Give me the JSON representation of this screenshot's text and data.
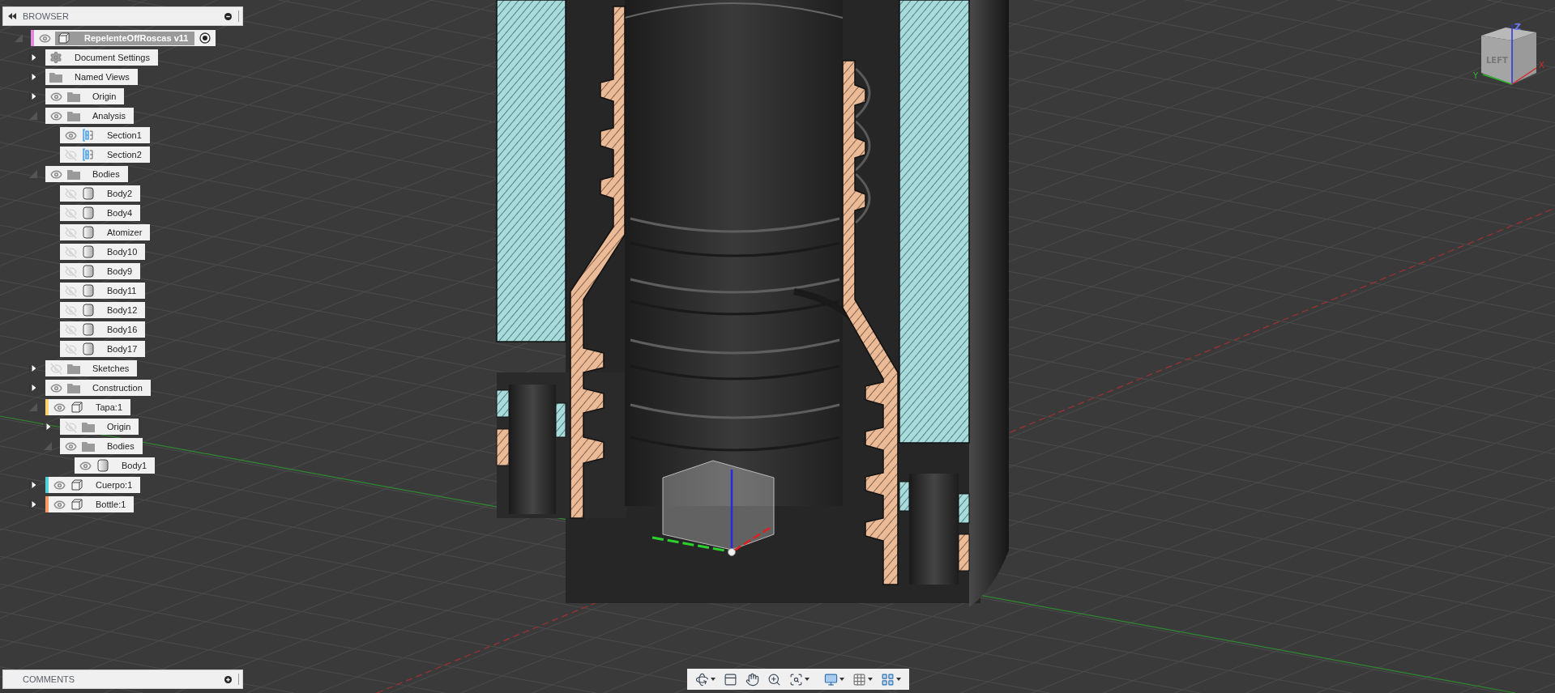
{
  "browser": {
    "title": "BROWSER",
    "root": {
      "label": "RepelenteOffRoscas v11",
      "kind": "component",
      "visible": true,
      "expanded": true,
      "color": "#e08ae0",
      "active": true,
      "children": [
        {
          "label": "Document Settings",
          "kind": "gear",
          "expanded": false
        },
        {
          "label": "Named Views",
          "kind": "folder",
          "expanded": false
        },
        {
          "label": "Origin",
          "kind": "folder",
          "visible": true,
          "expanded": false
        },
        {
          "label": "Analysis",
          "kind": "folder",
          "visible": true,
          "expanded": true,
          "children": [
            {
              "label": "Section1",
              "kind": "section",
              "visible": true
            },
            {
              "label": "Section2",
              "kind": "section",
              "visible": false
            }
          ]
        },
        {
          "label": "Bodies",
          "kind": "folder",
          "visible": true,
          "expanded": true,
          "children": [
            {
              "label": "Body2",
              "kind": "body",
              "visible": false
            },
            {
              "label": "Body4",
              "kind": "body",
              "visible": false
            },
            {
              "label": "Atomizer",
              "kind": "body",
              "visible": false
            },
            {
              "label": "Body10",
              "kind": "body",
              "visible": false
            },
            {
              "label": "Body9",
              "kind": "body",
              "visible": false
            },
            {
              "label": "Body11",
              "kind": "body",
              "visible": false
            },
            {
              "label": "Body12",
              "kind": "body",
              "visible": false
            },
            {
              "label": "Body16",
              "kind": "body",
              "visible": false
            },
            {
              "label": "Body17",
              "kind": "body",
              "visible": false
            }
          ]
        },
        {
          "label": "Sketches",
          "kind": "folder",
          "visible": false,
          "expanded": false
        },
        {
          "label": "Construction",
          "kind": "folder",
          "visible": true,
          "expanded": false
        },
        {
          "label": "Tapa:1",
          "kind": "component",
          "visible": true,
          "expanded": true,
          "color": "#ffd36e",
          "children": [
            {
              "label": "Origin",
              "kind": "folder",
              "visible": false,
              "expanded": false
            },
            {
              "label": "Bodies",
              "kind": "folder",
              "visible": true,
              "expanded": true,
              "children": [
                {
                  "label": "Body1",
                  "kind": "body",
                  "visible": true
                }
              ]
            }
          ]
        },
        {
          "label": "Cuerpo:1",
          "kind": "component",
          "visible": true,
          "expanded": false,
          "color": "#4fd3db"
        },
        {
          "label": "Bottle:1",
          "kind": "component",
          "visible": true,
          "expanded": false,
          "color": "#ff9a62"
        }
      ]
    }
  },
  "view_cube": {
    "face_label": "LEFT",
    "axis_labels": {
      "x": "X",
      "y": "Y",
      "z": "Z"
    }
  },
  "toolbar": {
    "tools": [
      {
        "kind": "orbit",
        "menu": true
      },
      {
        "kind": "look",
        "menu": false
      },
      {
        "kind": "pan",
        "menu": false
      },
      {
        "kind": "zoom",
        "menu": false
      },
      {
        "kind": "fit",
        "menu": true
      },
      {
        "kind": "display",
        "menu": true
      },
      {
        "kind": "grid",
        "menu": true
      },
      {
        "kind": "viewports",
        "menu": true
      }
    ]
  },
  "comments": {
    "title": "COMMENTS"
  }
}
